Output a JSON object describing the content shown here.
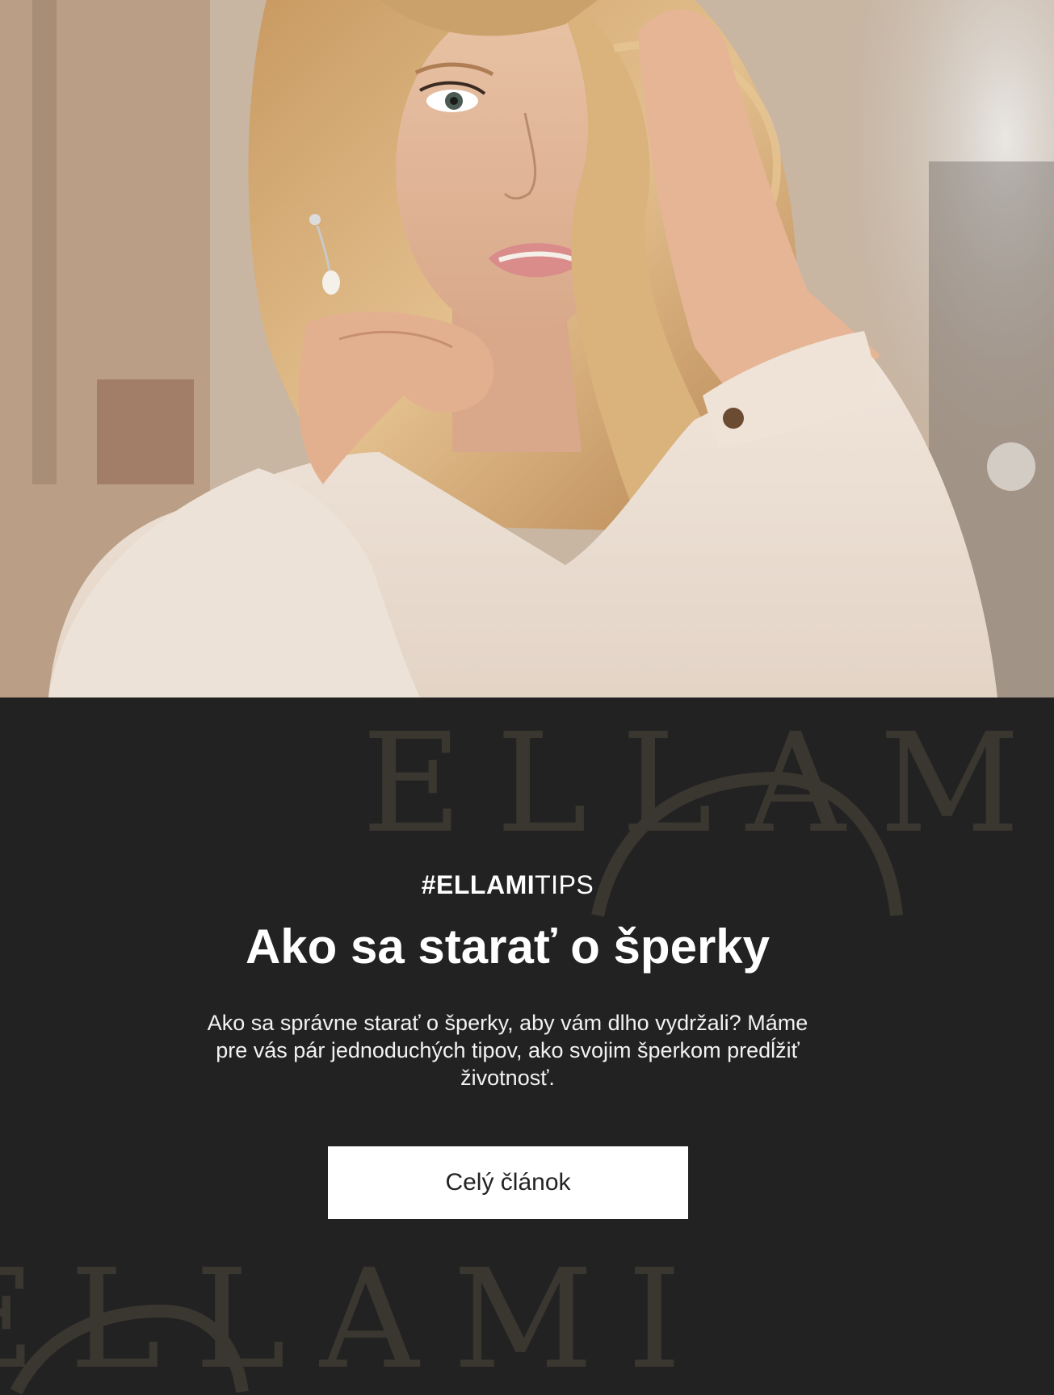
{
  "hero": {
    "image_alt": "Woman with blonde hair wearing pearl earring and white blouse"
  },
  "watermark": {
    "top_text": "ELLAMI",
    "bottom_text": "ELLAMI"
  },
  "article": {
    "tag_bold": "#ELLAMI",
    "tag_rest": "TIPS",
    "title": "Ako sa starať o šperky",
    "description": "Ako sa správne starať o šperky, aby vám dlho vydržali? Máme pre vás pár jednoduchých tipov, ako svojim šperkom predĺžiť životnosť.",
    "cta_label": "Celý článok"
  },
  "colors": {
    "background": "#222222",
    "watermark": "#3a3630",
    "text": "#ffffff",
    "button_bg": "#ffffff",
    "button_text": "#222222"
  }
}
